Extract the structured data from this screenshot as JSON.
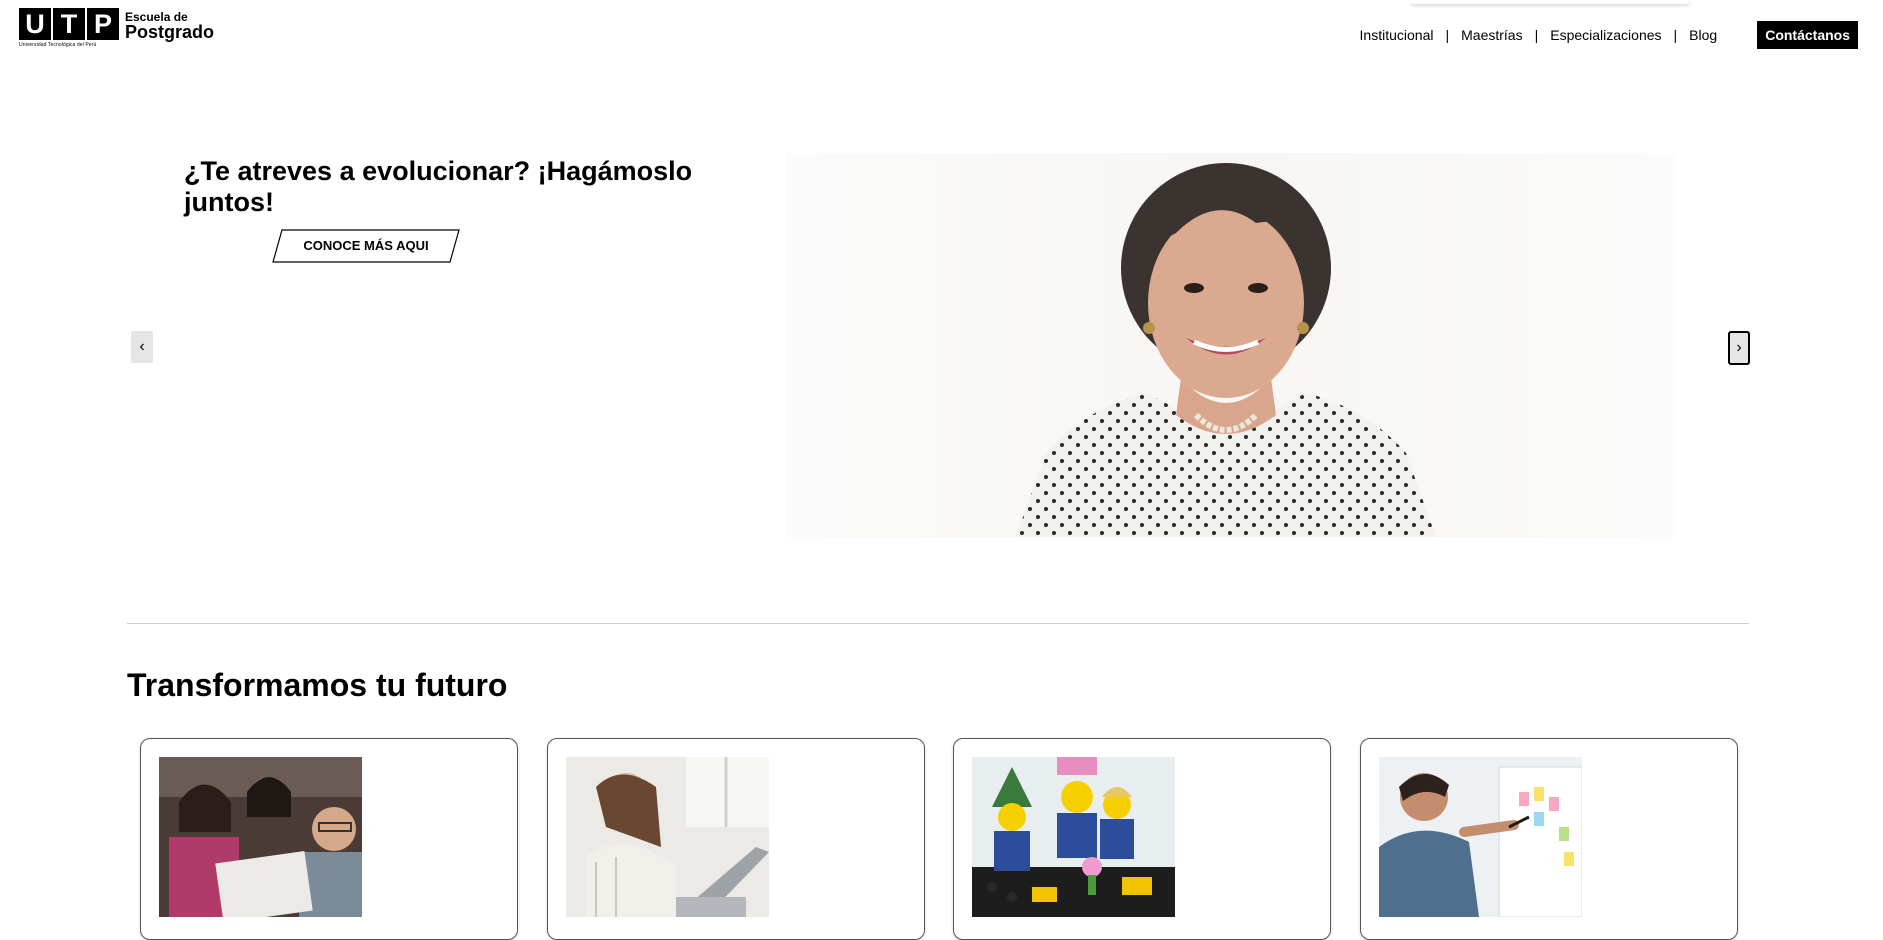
{
  "logo": {
    "letters": [
      "U",
      "T",
      "P"
    ],
    "subtitle": "Universidad Tecnológica del Perú",
    "school_line1": "Escuela de",
    "school_line2": "Postgrado"
  },
  "nav": {
    "items": [
      {
        "label": "Institucional"
      },
      {
        "label": "Maestrías"
      },
      {
        "label": "Especializaciones"
      },
      {
        "label": "Blog"
      }
    ],
    "separator": "|",
    "cta_label": "Contáctanos"
  },
  "hero": {
    "title": "¿Te atreves a evolucionar? ¡Hagámoslo juntos!",
    "button_label": "CONOCE MÁS AQUI",
    "prev_arrow": "‹",
    "next_arrow": "›"
  },
  "section": {
    "title": "Transformamos tu futuro"
  },
  "colors": {
    "primary": "#000000",
    "background": "#ffffff",
    "divider": "#cfcfcf"
  }
}
